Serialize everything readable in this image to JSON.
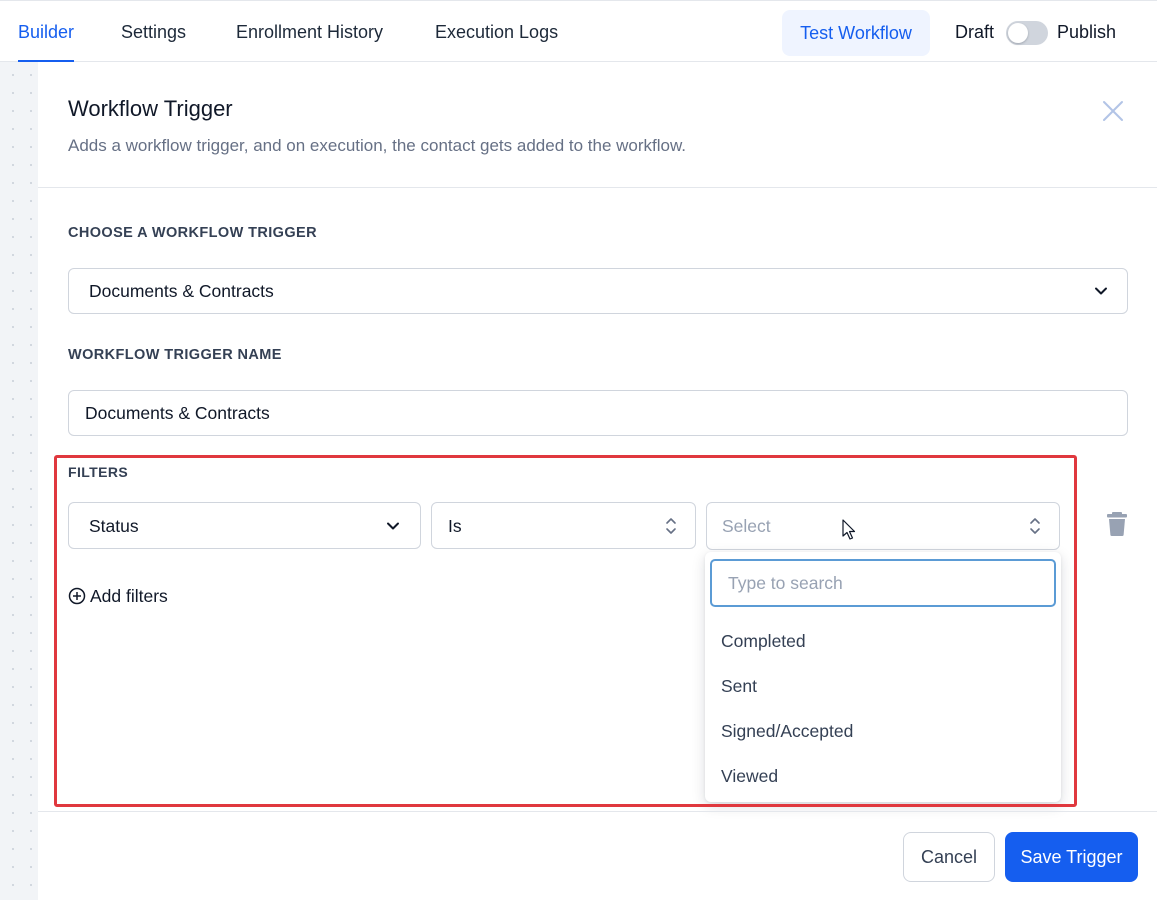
{
  "topbar": {
    "tabs": [
      {
        "label": "Builder",
        "active": true
      },
      {
        "label": "Settings",
        "active": false
      },
      {
        "label": "Enrollment History",
        "active": false
      },
      {
        "label": "Execution Logs",
        "active": false
      }
    ],
    "test_workflow_label": "Test Workflow",
    "draft_label": "Draft",
    "publish_label": "Publish",
    "published": false
  },
  "panel": {
    "title": "Workflow Trigger",
    "subtitle": "Adds a workflow trigger, and on execution, the contact gets added to the workflow.",
    "trigger_section_label": "CHOOSE A WORKFLOW TRIGGER",
    "trigger_value": "Documents & Contracts",
    "name_section_label": "WORKFLOW TRIGGER NAME",
    "name_value": "Documents & Contracts",
    "filters_label": "FILTERS",
    "filter": {
      "field": "Status",
      "operator": "Is",
      "value_placeholder": "Select"
    },
    "add_filters_label": "Add filters",
    "dropdown": {
      "search_placeholder": "Type to search",
      "options": [
        "Completed",
        "Sent",
        "Signed/Accepted",
        "Viewed"
      ]
    },
    "cancel_label": "Cancel",
    "save_label": "Save Trigger"
  },
  "colors": {
    "accent": "#155eef",
    "highlight": "#e0383e"
  }
}
